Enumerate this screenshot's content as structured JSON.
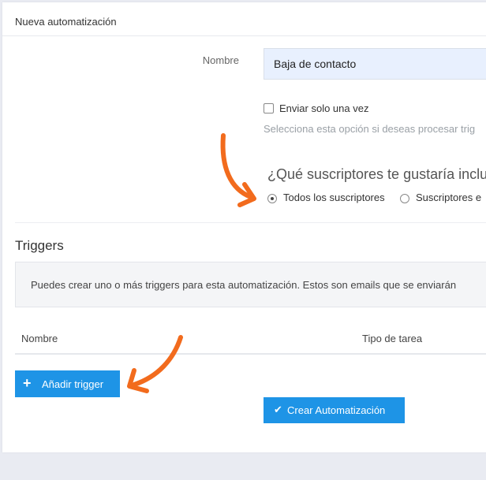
{
  "panel": {
    "title": "Nueva automatización"
  },
  "form": {
    "name_label": "Nombre",
    "name_value": "Baja de contacto",
    "send_once_label": "Enviar solo una vez",
    "send_once_checked": false,
    "send_once_help": "Selecciona esta opción si deseas procesar trig",
    "subscribers_question": "¿Qué suscriptores te gustaría inclu",
    "radio_options": [
      {
        "label": "Todos los suscriptores",
        "checked": true
      },
      {
        "label": "Suscriptores e",
        "checked": false
      }
    ]
  },
  "triggers": {
    "title": "Triggers",
    "info": "Puedes crear uno o más triggers para esta automatización. Estos son emails que se enviarán",
    "columns": [
      "Nombre",
      "Tipo de tarea"
    ],
    "add_button": "Añadir trigger",
    "add_icon": "plus-icon"
  },
  "actions": {
    "create_button": "Crear Automatización",
    "create_icon": "check-icon"
  },
  "colors": {
    "primary": "#1e94e6",
    "annotation_arrow": "#f26b1d",
    "input_bg": "#e8f0fe"
  }
}
